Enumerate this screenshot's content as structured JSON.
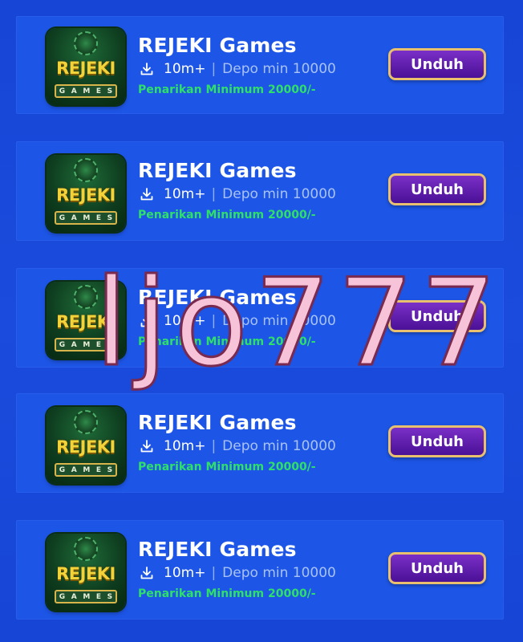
{
  "apps": [
    {
      "logo_word": "REJEKI",
      "logo_letters": [
        "G",
        "A",
        "M",
        "E",
        "S"
      ],
      "name": "REJEKI Games",
      "downloads": "10m+",
      "separator": "|",
      "depo": "Depo min 10000",
      "penarikan": "Penarikan Minimum 20000/-",
      "button": "Unduh"
    },
    {
      "logo_word": "REJEKI",
      "logo_letters": [
        "G",
        "A",
        "M",
        "E",
        "S"
      ],
      "name": "REJEKI Games",
      "downloads": "10m+",
      "separator": "|",
      "depo": "Depo min 10000",
      "penarikan": "Penarikan Minimum 20000/-",
      "button": "Unduh"
    },
    {
      "logo_word": "REJEKI",
      "logo_letters": [
        "G",
        "A",
        "M",
        "E",
        "S"
      ],
      "name": "REJEKI Games",
      "downloads": "10m+",
      "separator": "|",
      "depo": "Depo min 10000",
      "penarikan": "Penarikan Minimum 20000/-",
      "button": "Unduh"
    },
    {
      "logo_word": "REJEKI",
      "logo_letters": [
        "G",
        "A",
        "M",
        "E",
        "S"
      ],
      "name": "REJEKI Games",
      "downloads": "10m+",
      "separator": "|",
      "depo": "Depo min 10000",
      "penarikan": "Penarikan Minimum 20000/-",
      "button": "Unduh"
    },
    {
      "logo_word": "REJEKI",
      "logo_letters": [
        "G",
        "A",
        "M",
        "E",
        "S"
      ],
      "name": "REJEKI Games",
      "downloads": "10m+",
      "separator": "|",
      "depo": "Depo min 10000",
      "penarikan": "Penarikan Minimum 20000/-",
      "button": "Unduh"
    }
  ],
  "watermark": "ljo777",
  "icons": {
    "download": "download-icon",
    "logo": "rejeki-games-logo-icon"
  },
  "colors": {
    "background": "#1a4bdc",
    "card": "#1d55e6",
    "title": "#ffffff",
    "depo_text": "#a9c3f7",
    "penarikan_text": "#2ee06a",
    "button_fill": "#5a1aa8",
    "button_border": "#e8c06e",
    "logo_gold": "#f3d33a",
    "watermark_fill": "#f7c3d8"
  }
}
